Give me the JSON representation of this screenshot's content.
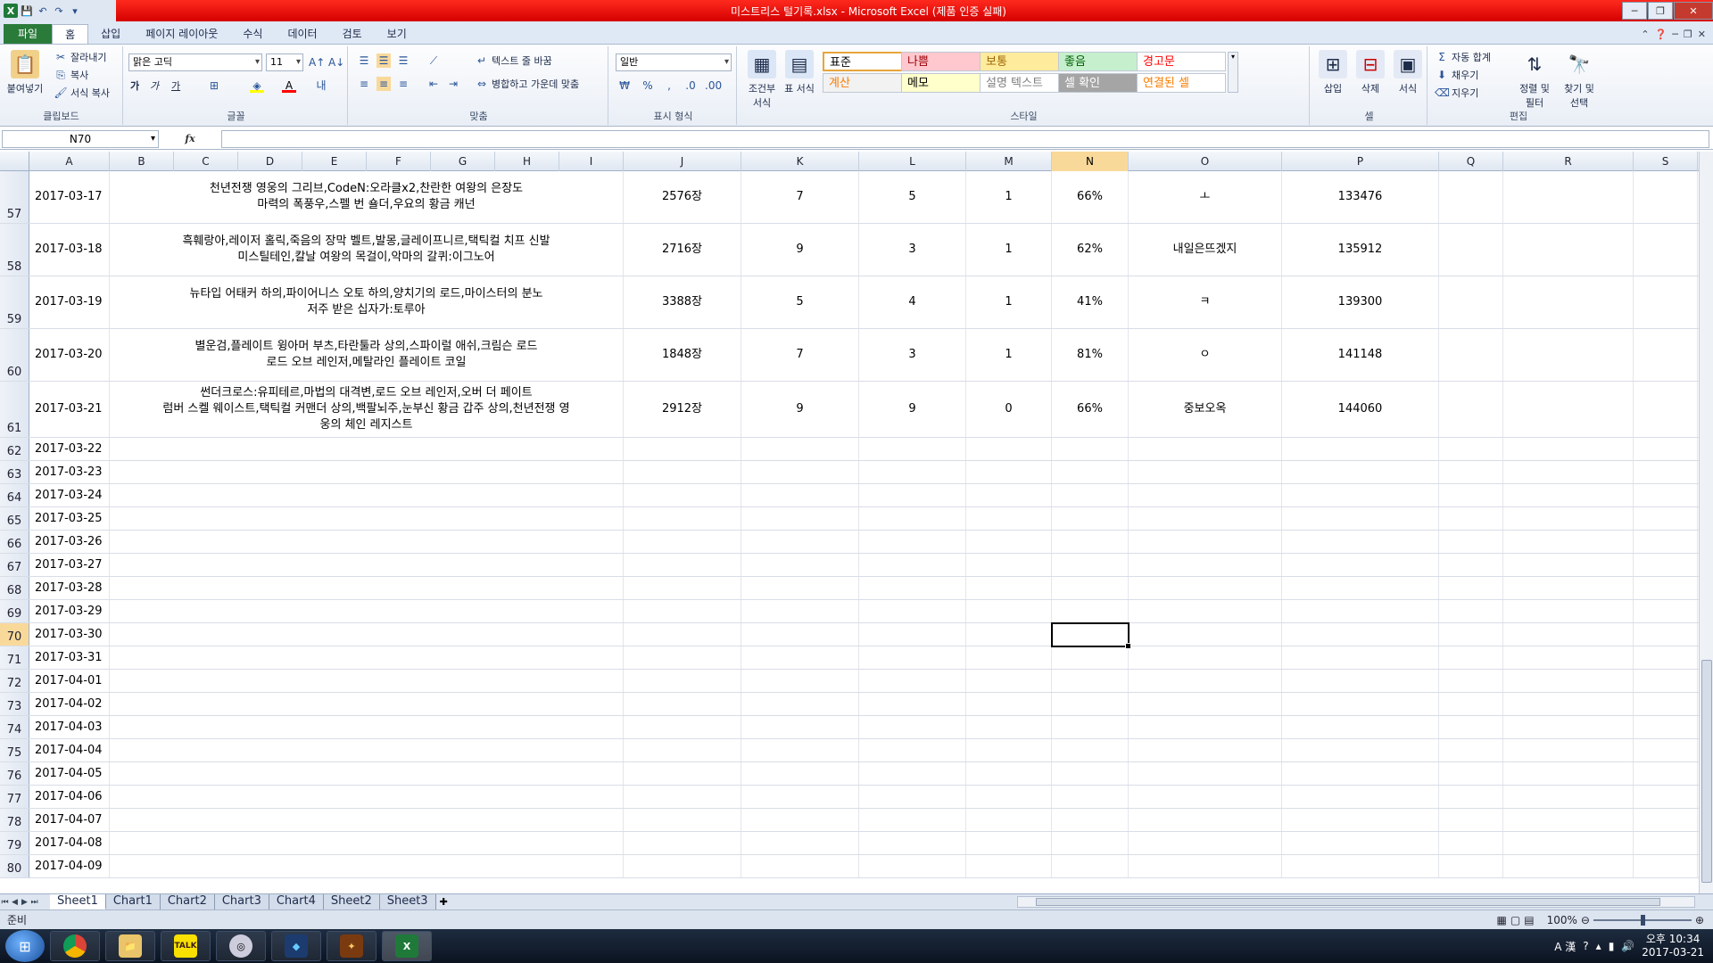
{
  "window": {
    "title": "미스트리스 털기록.xlsx  -  Microsoft Excel (제품 인증 실패)"
  },
  "menu": {
    "tabs": [
      "파일",
      "홈",
      "삽입",
      "페이지 레이아웃",
      "수식",
      "데이터",
      "검토",
      "보기"
    ]
  },
  "ribbon": {
    "clipboard": {
      "paste": "붙여넣기",
      "cut": "잘라내기",
      "copy": "복사",
      "format_painter": "서식 복사",
      "label": "클립보드"
    },
    "font": {
      "name": "맑은 고딕",
      "size": "11",
      "label": "글꼴",
      "bold": "가",
      "italic": "가",
      "underline": "가"
    },
    "alignment": {
      "wrap": "텍스트 줄 바꿈",
      "merge": "병합하고 가운데 맞춤",
      "label": "맞춤"
    },
    "number": {
      "format": "일반",
      "label": "표시 형식"
    },
    "styles": {
      "conditional": "조건부 서식",
      "table": "표 서식",
      "label": "스타일",
      "cells": [
        {
          "text": "표준",
          "bg": "#ffffff",
          "color": "#000000"
        },
        {
          "text": "나쁨",
          "bg": "#ffc7ce",
          "color": "#9c0006"
        },
        {
          "text": "보통",
          "bg": "#ffeb9c",
          "color": "#9c6500"
        },
        {
          "text": "좋음",
          "bg": "#c6efce",
          "color": "#006100"
        },
        {
          "text": "경고문",
          "bg": "#ffffff",
          "color": "#ff0000"
        },
        {
          "text": "계산",
          "bg": "#f2f2f2",
          "color": "#fa7d00"
        },
        {
          "text": "메모",
          "bg": "#ffffcc",
          "color": "#000000"
        },
        {
          "text": "설명 텍스트",
          "bg": "#ffffff",
          "color": "#7f7f7f"
        },
        {
          "text": "셀 확인",
          "bg": "#a5a5a5",
          "color": "#ffffff"
        },
        {
          "text": "연결된 셀",
          "bg": "#ffffff",
          "color": "#fa7d00"
        }
      ]
    },
    "cells": {
      "insert": "삽입",
      "delete": "삭제",
      "format": "서식",
      "label": "셀"
    },
    "editing": {
      "autosum": "자동 합계",
      "fill": "채우기",
      "clear": "지우기",
      "sort": "정렬 및 필터",
      "find": "찾기 및 선택",
      "label": "편집"
    }
  },
  "formula_bar": {
    "name_box": "N70",
    "fx": "fx",
    "value": ""
  },
  "columns": [
    "A",
    "B",
    "C",
    "D",
    "E",
    "F",
    "G",
    "H",
    "I",
    "J",
    "K",
    "L",
    "M",
    "N",
    "O",
    "P",
    "Q",
    "R",
    "S"
  ],
  "selected_column": "N",
  "selected_row": "70",
  "rows": [
    {
      "num": "57",
      "date": "2017-03-17",
      "items": "천년전쟁 영웅의 그리브,CodeN:오라클x2,찬란한 여왕의 은장도\n마력의 폭풍우,스펠 번 숄더,우요의 황금 캐넌",
      "j": "2576장",
      "k": "7",
      "l": "5",
      "m": "1",
      "n": "66%",
      "o": "ㅗ",
      "p": "133476"
    },
    {
      "num": "58",
      "date": "2017-03-18",
      "items": "흑훼랑아,레이저 홀릭,죽음의 장막 벨트,발몽,글레이프니르,택틱컬 치프 신발\n미스틸테인,칼날 여왕의 목걸이,악마의 갈퀴:이그노어",
      "j": "2716장",
      "k": "9",
      "l": "3",
      "m": "1",
      "n": "62%",
      "o": "내일은뜨겠지",
      "p": "135912"
    },
    {
      "num": "59",
      "date": "2017-03-19",
      "items": "뉴타입 어태커 하의,파이어니스 오토 하의,양치기의 로드,마이스터의 분노\n저주 받은 십자가:토루아",
      "j": "3388장",
      "k": "5",
      "l": "4",
      "m": "1",
      "n": "41%",
      "o": "ㅋ",
      "p": "139300"
    },
    {
      "num": "60",
      "date": "2017-03-20",
      "items": "별운검,플레이트 윙아머 부츠,타란툴라 상의,스파이럴 애쉬,크림슨 로드\n로드 오브 레인저,메탈라인 플레이트 코일",
      "j": "1848장",
      "k": "7",
      "l": "3",
      "m": "1",
      "n": "81%",
      "o": "ㅇ",
      "p": "141148"
    },
    {
      "num": "61",
      "date": "2017-03-21",
      "items": "썬더크로스:유피테르,마법의 대격변,로드 오브 레인저,오버 더 페이트\n럼버 스켈 웨이스트,택틱컬 커맨더 상의,백팔뇌주,눈부신 황금 갑주 상의,천년전쟁 영\n웅의 체인 레지스트",
      "j": "2912장",
      "k": "9",
      "l": "9",
      "m": "0",
      "n": "66%",
      "o": "중보오옥",
      "p": "144060"
    },
    {
      "num": "62",
      "date": "2017-03-22"
    },
    {
      "num": "63",
      "date": "2017-03-23"
    },
    {
      "num": "64",
      "date": "2017-03-24"
    },
    {
      "num": "65",
      "date": "2017-03-25"
    },
    {
      "num": "66",
      "date": "2017-03-26"
    },
    {
      "num": "67",
      "date": "2017-03-27"
    },
    {
      "num": "68",
      "date": "2017-03-28"
    },
    {
      "num": "69",
      "date": "2017-03-29"
    },
    {
      "num": "70",
      "date": "2017-03-30"
    },
    {
      "num": "71",
      "date": "2017-03-31"
    },
    {
      "num": "72",
      "date": "2017-04-01"
    },
    {
      "num": "73",
      "date": "2017-04-02"
    },
    {
      "num": "74",
      "date": "2017-04-03"
    },
    {
      "num": "75",
      "date": "2017-04-04"
    },
    {
      "num": "76",
      "date": "2017-04-05"
    },
    {
      "num": "77",
      "date": "2017-04-06"
    },
    {
      "num": "78",
      "date": "2017-04-07"
    },
    {
      "num": "79",
      "date": "2017-04-08"
    },
    {
      "num": "80",
      "date": "2017-04-09"
    }
  ],
  "sheets": [
    "Sheet1",
    "Chart1",
    "Chart2",
    "Chart3",
    "Chart4",
    "Sheet2",
    "Sheet3"
  ],
  "active_sheet": "Sheet1",
  "status": {
    "mode": "준비",
    "zoom": "100%"
  },
  "taskbar": {
    "apps": [
      "chrome-icon",
      "explorer-icon",
      "kakaotalk-icon",
      "media-icon",
      "app-icon",
      "game-icon",
      "excel-icon"
    ],
    "kakao_label": "TALK",
    "ime": "A 漢",
    "time": "오후 10:34",
    "date": "2017-03-21"
  }
}
